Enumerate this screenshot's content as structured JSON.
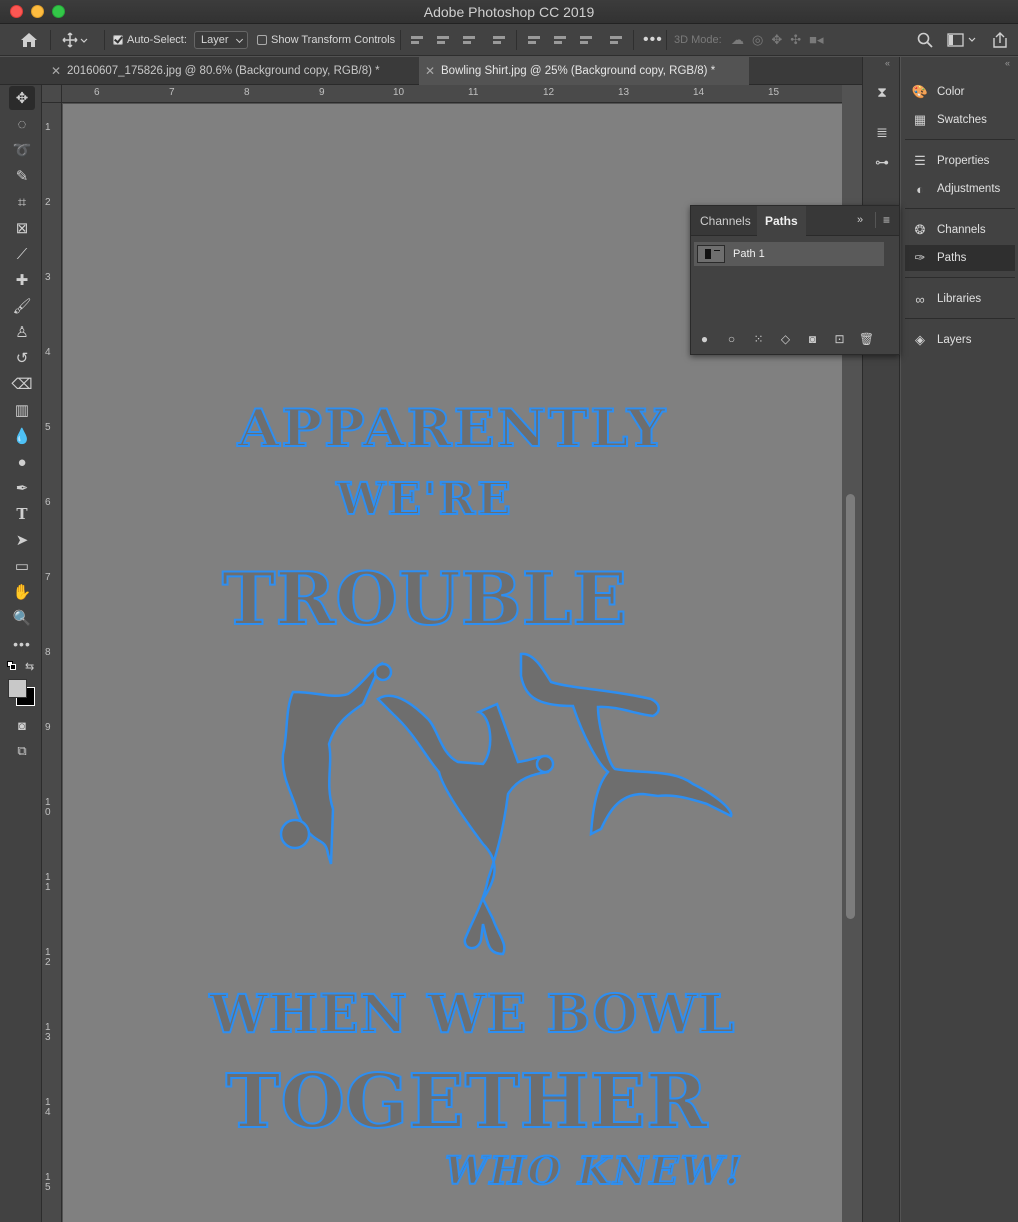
{
  "window": {
    "title": "Adobe Photoshop CC 2019"
  },
  "options_bar": {
    "auto_select_label": "Auto-Select:",
    "auto_select_checked": true,
    "auto_select_target": "Layer",
    "show_transform_label": "Show Transform Controls",
    "show_transform_checked": false,
    "mode_3d_label": "3D Mode:"
  },
  "tabs": [
    {
      "label": "20160607_175826.jpg @ 80.6% (Background copy, RGB/8) *",
      "active": false
    },
    {
      "label": "Bowling Shirt.jpg @ 25% (Background copy, RGB/8) *",
      "active": true
    }
  ],
  "ruler": {
    "horizontal": [
      "6",
      "7",
      "8",
      "9",
      "10",
      "11",
      "12",
      "13",
      "14",
      "15"
    ],
    "vertical": [
      "1",
      "2",
      "3",
      "4",
      "5",
      "6",
      "7",
      "8",
      "9",
      "1 0",
      "1 1",
      "1 2",
      "1 3",
      "1 4",
      "1 5"
    ]
  },
  "artwork": {
    "line1": "APPARENTLY",
    "line2": "WE'RE",
    "line3": "TROUBLE",
    "line4": "WHEN WE BOWL",
    "line5": "TOGETHER",
    "line6": "WHO KNEW!",
    "path_color": "#2e8ef0"
  },
  "paths_panel": {
    "tabs": [
      "Channels",
      "Paths"
    ],
    "active_tab": "Paths",
    "items": [
      {
        "label": "Path 1"
      }
    ]
  },
  "right_panel": {
    "items": [
      {
        "label": "Color",
        "icon": "color-palette-icon"
      },
      {
        "label": "Swatches",
        "icon": "swatches-grid-icon"
      },
      {
        "label": "Properties",
        "icon": "properties-icon"
      },
      {
        "label": "Adjustments",
        "icon": "adjustments-icon"
      },
      {
        "label": "Channels",
        "icon": "channels-icon"
      },
      {
        "label": "Paths",
        "icon": "paths-icon"
      },
      {
        "label": "Libraries",
        "icon": "libraries-icon"
      },
      {
        "label": "Layers",
        "icon": "layers-icon"
      }
    ]
  }
}
